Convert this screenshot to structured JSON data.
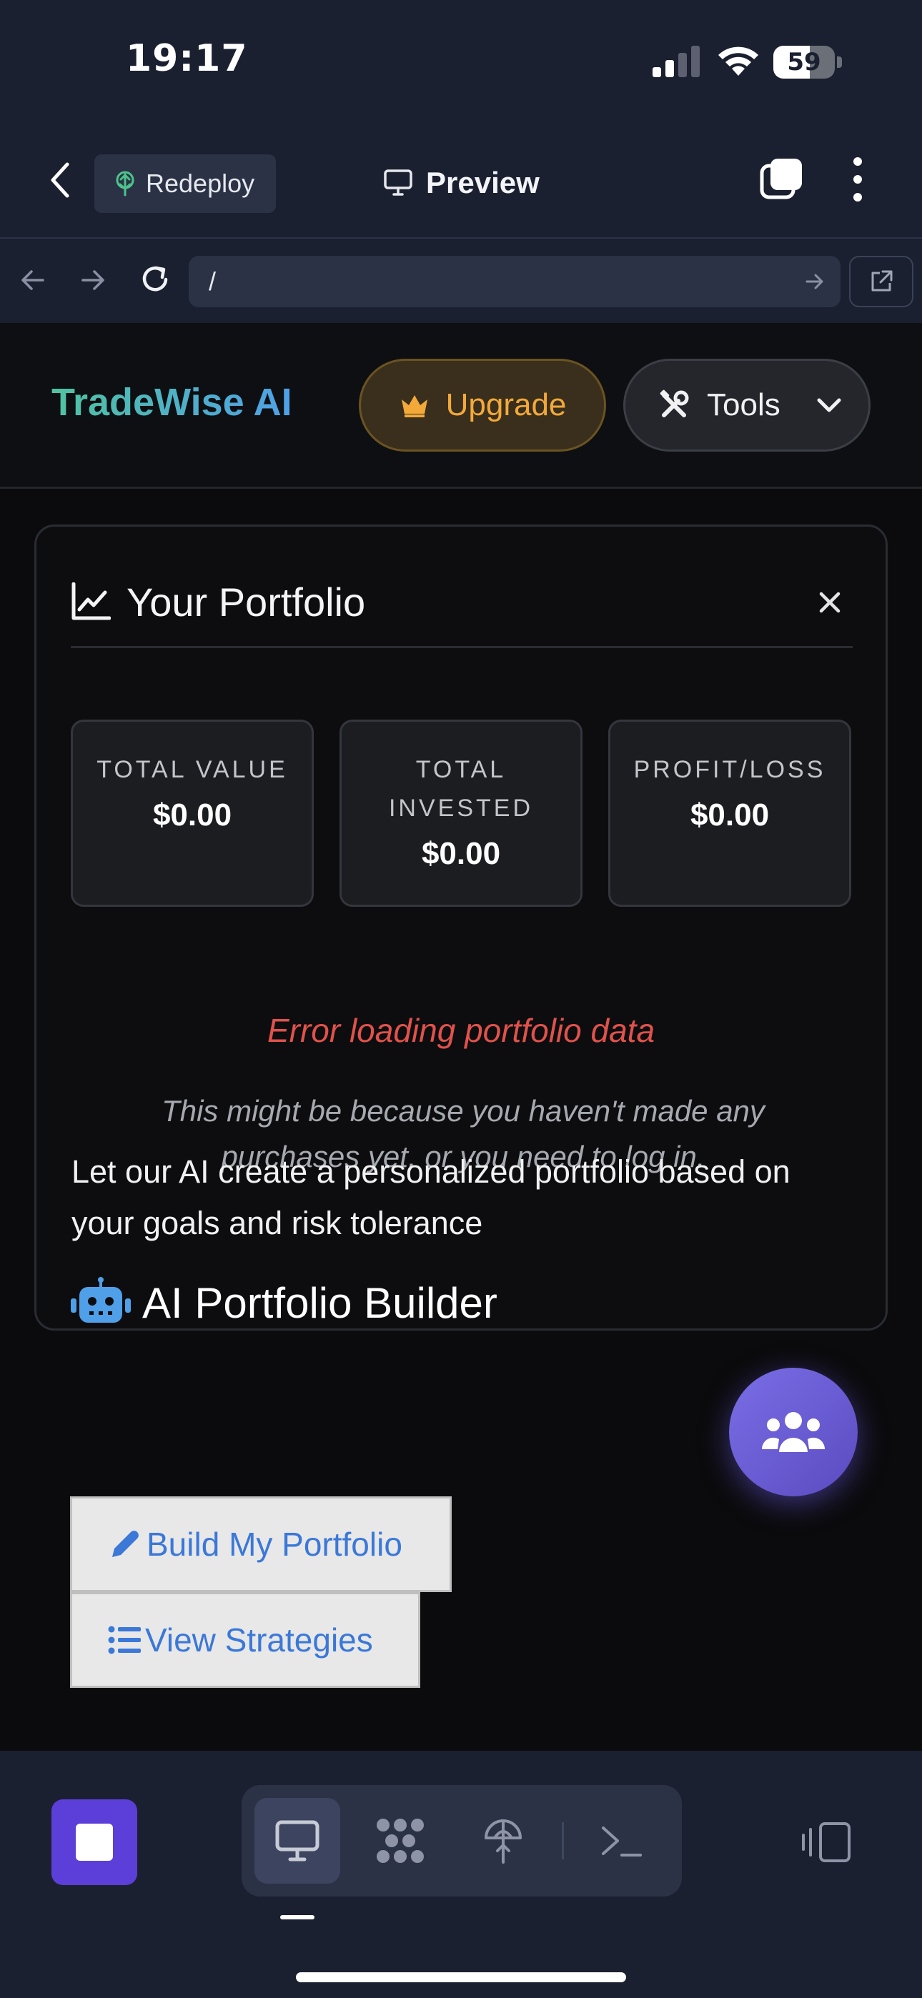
{
  "status_bar": {
    "time": "19:17",
    "battery_level": "59",
    "battery_fraction": 0.59
  },
  "app_bar": {
    "redeploy_label": "Redeploy",
    "preview_label": "Preview"
  },
  "url_bar": {
    "path": "/"
  },
  "site": {
    "brand": "TradeWise AI",
    "upgrade_label": "Upgrade",
    "tools_label": "Tools",
    "colors": {
      "brand_gradient_start": "#4fc3a1",
      "brand_gradient_end": "#4fa0e8",
      "upgrade_accent": "#f3a93a",
      "error": "#e0524b",
      "action_text": "#3b78d8",
      "fab": "#6b5fd8"
    }
  },
  "portfolio": {
    "title": "Your Portfolio",
    "stats": [
      {
        "label": "TOTAL VALUE",
        "value": "$0.00"
      },
      {
        "label": "TOTAL INVESTED",
        "value": "$0.00"
      },
      {
        "label": "PROFIT/LOSS",
        "value": "$0.00"
      }
    ],
    "error_title": "Error loading portfolio data",
    "error_hint": "This might be because you haven't made any purchases yet, or you need to log in."
  },
  "ai_builder": {
    "title": "AI Portfolio Builder",
    "description": "Let our AI create a personalized portfolio based on your goals and risk tolerance",
    "build_label": "Build My Portfolio",
    "strategies_label": "View Strategies"
  },
  "icons": {
    "status": [
      "signal-icon",
      "wifi-icon",
      "battery-icon"
    ],
    "app_bar": [
      "back-chevron-icon",
      "redeploy-icon",
      "monitor-icon",
      "tabs-icon",
      "more-vertical-icon"
    ],
    "url_bar": [
      "nav-back-icon",
      "nav-forward-icon",
      "reload-icon",
      "go-arrow-icon",
      "external-link-icon"
    ],
    "page": [
      "crown-icon",
      "tools-icon",
      "chevron-down-icon",
      "chart-line-icon",
      "close-icon",
      "robot-icon",
      "pencil-icon",
      "list-icon",
      "users-icon"
    ],
    "bottom_bar": [
      "stop-icon",
      "preview-monitor-icon",
      "workflows-icon",
      "deploy-icon",
      "shell-icon",
      "devices-icon"
    ]
  }
}
